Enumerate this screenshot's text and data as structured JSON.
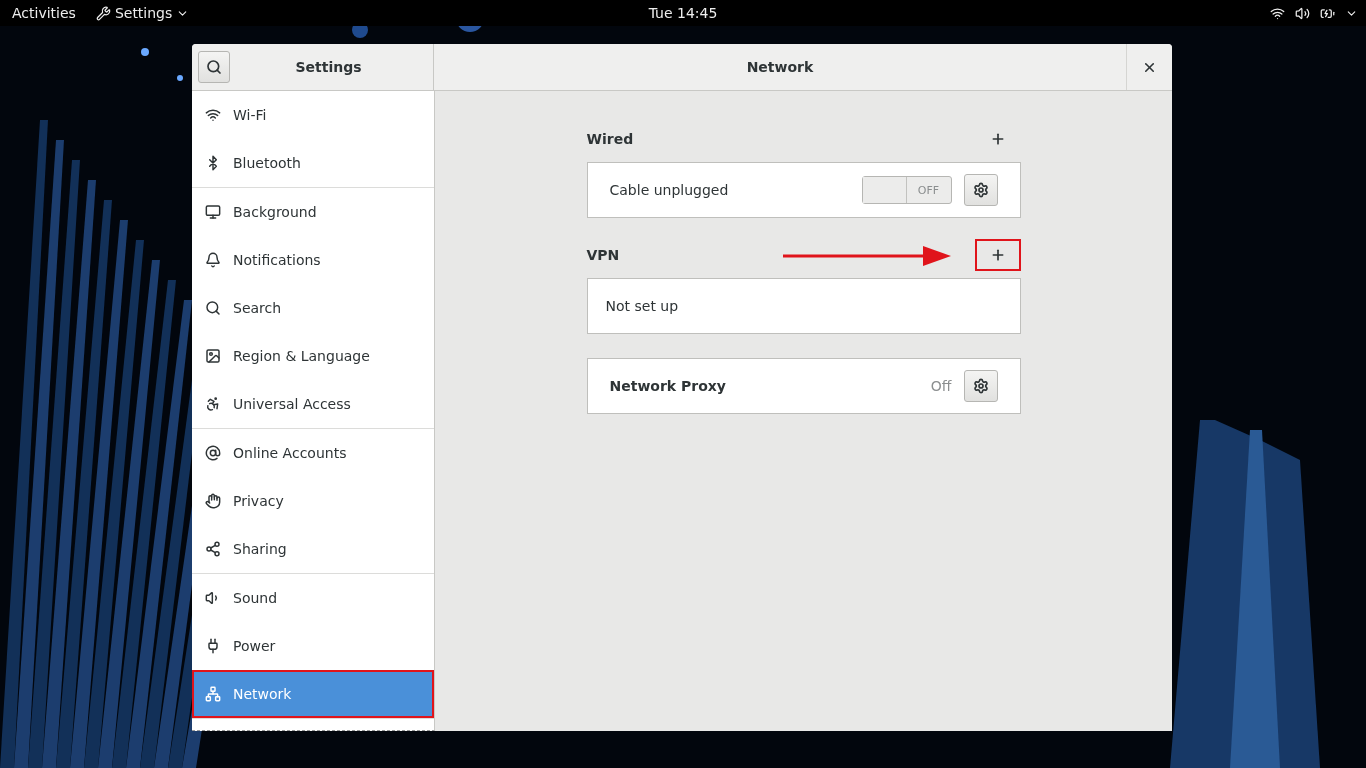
{
  "top_bar": {
    "activities": "Activities",
    "app_menu": "Settings",
    "clock": "Tue 14:45"
  },
  "window": {
    "sidebar_title": "Settings",
    "title": "Network"
  },
  "sidebar": {
    "groups": [
      {
        "items": [
          {
            "label": "Wi-Fi",
            "selected": false
          },
          {
            "label": "Bluetooth",
            "selected": false
          }
        ]
      },
      {
        "items": [
          {
            "label": "Background",
            "selected": false
          },
          {
            "label": "Notifications",
            "selected": false
          },
          {
            "label": "Search",
            "selected": false
          },
          {
            "label": "Region & Language",
            "selected": false
          },
          {
            "label": "Universal Access",
            "selected": false
          }
        ]
      },
      {
        "items": [
          {
            "label": "Online Accounts",
            "selected": false
          },
          {
            "label": "Privacy",
            "selected": false
          },
          {
            "label": "Sharing",
            "selected": false
          }
        ]
      },
      {
        "items": [
          {
            "label": "Sound",
            "selected": false
          },
          {
            "label": "Power",
            "selected": false
          },
          {
            "label": "Network",
            "selected": true
          }
        ]
      }
    ]
  },
  "sections": [
    {
      "title": "Wired",
      "rows": [
        {
          "kind": "switch",
          "label": "Cable unplugged",
          "on": false,
          "switch_label": "OFF"
        }
      ]
    },
    {
      "title": "VPN",
      "rows": [
        {
          "kind": "empty",
          "label": "Not set up"
        }
      ]
    },
    {
      "rows": [
        {
          "kind": "status",
          "label": "Network Proxy",
          "status": "Off"
        }
      ]
    }
  ]
}
